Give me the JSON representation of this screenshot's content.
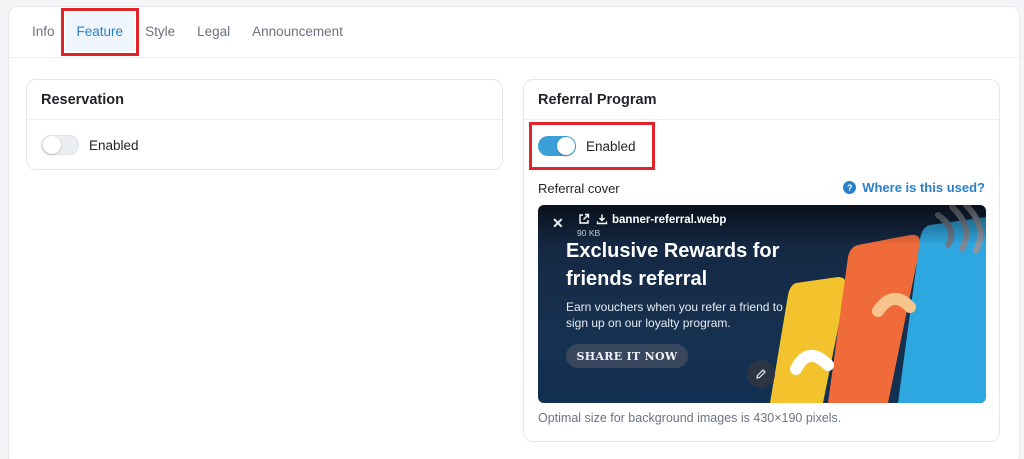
{
  "tabs": [
    {
      "label": "Info"
    },
    {
      "label": "Feature"
    },
    {
      "label": "Style"
    },
    {
      "label": "Legal"
    },
    {
      "label": "Announcement"
    }
  ],
  "active_tab": "Feature",
  "reservation": {
    "title": "Reservation",
    "toggle_label": "Enabled",
    "enabled": false
  },
  "referral": {
    "title": "Referral Program",
    "toggle_label": "Enabled",
    "enabled": true,
    "cover_label": "Referral cover",
    "help_link": "Where is this used?",
    "file_name": "banner-referral.webp",
    "file_size": "90 KB",
    "caption": "Optimal size for background images is 430×190 pixels.",
    "banner": {
      "title": "Exclusive Rewards for friends referral",
      "subtitle": "Earn vouchers when you refer a friend to sign up on our loyalty program.",
      "button": "SHARE IT NOW"
    }
  },
  "colors": {
    "accent": "#2a7fc7",
    "toggle_on": "#3b9fd8",
    "highlight": "#e0242a",
    "card_yellow": "#f2c32c",
    "card_orange": "#f06b3a",
    "card_blue": "#2ea7e0"
  },
  "icons": [
    "question-circle-icon",
    "close-icon",
    "external-link-icon",
    "download-icon",
    "pencil-icon"
  ]
}
